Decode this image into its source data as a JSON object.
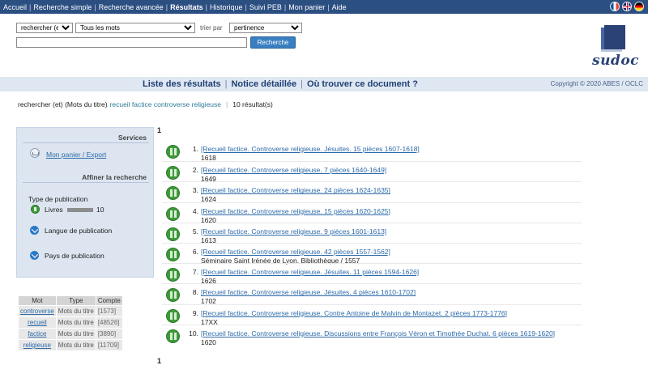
{
  "nav": {
    "items": [
      {
        "label": "Accueil",
        "active": false
      },
      {
        "label": "Recherche simple",
        "active": false
      },
      {
        "label": "Recherche avancée",
        "active": false
      },
      {
        "label": "Résultats",
        "active": true
      },
      {
        "label": "Historique",
        "active": false
      },
      {
        "label": "Suivi PEB",
        "active": false
      },
      {
        "label": "Mon panier",
        "active": false
      },
      {
        "label": "Aide",
        "active": false
      }
    ],
    "separator": "|",
    "flags": [
      "flag-fr-icon",
      "flag-gb-icon",
      "flag-de-icon"
    ]
  },
  "search": {
    "operator_value": "rechercher (et)",
    "field_value": "Tous les mots",
    "sort_label": "trier par",
    "sort_value": "pertinence",
    "query_value": "",
    "button_label": "Recherche"
  },
  "logo": {
    "text": "sudoc"
  },
  "tabs": {
    "items": [
      "Liste des résultats",
      "Notice détaillée",
      "Où trouver ce document ?"
    ],
    "separator": "|",
    "copyright": "Copyright © 2020 ABES / OCLC"
  },
  "breadcrumb": {
    "prefix": "rechercher (et) (Mots du titre)",
    "terms": "recueil factice controverse religieuse",
    "separator": "|",
    "count": "10 résultat(s)"
  },
  "panel": {
    "services_title": "Services",
    "basket_link": "Mon panier / Export",
    "refine_title": "Affiner la recherche",
    "pub_type_label": "Type de publication",
    "livres_label": "Livres",
    "livres_count": "10",
    "livres_fraction": 1.0,
    "langue_label": "Langue de publication",
    "pays_label": "Pays de publication"
  },
  "terms_table": {
    "headers": [
      "Mot",
      "Type",
      "Compte"
    ],
    "rows": [
      {
        "word": "controverse",
        "type": "Mots du titre",
        "count": "[1573]"
      },
      {
        "word": "recueil",
        "type": "Mots du titre",
        "count": "[48526]"
      },
      {
        "word": "factice",
        "type": "Mots du titre",
        "count": "[3890]"
      },
      {
        "word": "religieuse",
        "type": "Mots du titre",
        "count": "[11709]"
      }
    ]
  },
  "pager": {
    "top": "1",
    "bottom": "1"
  },
  "results": [
    {
      "num": "1.",
      "title": "[Recueil factice. Controverse religieuse. Jésuites. 15 pièces 1607-1618]",
      "meta": "1618"
    },
    {
      "num": "2.",
      "title": "[Recueil factice. Controverse religieuse. 7 pièces 1640-1649]",
      "meta": "1649"
    },
    {
      "num": "3.",
      "title": "[Recueil factice. Controverse religieuse. 24 pièces 1624-1635]",
      "meta": "1624"
    },
    {
      "num": "4.",
      "title": "[Recueil factice. Controverse religieuse. 15 pièces 1620-1625]",
      "meta": "1620"
    },
    {
      "num": "5.",
      "title": "[Recueil factice. Controverse religieuse. 9 pièces 1601-1613]",
      "meta": "1613"
    },
    {
      "num": "6.",
      "title": "[Recueil factice. Controverse religieuse. 42 pièces 1557-1562]",
      "meta": "Séminaire Saint Irénée de Lyon. Bibliothèque / 1557"
    },
    {
      "num": "7.",
      "title": "[Recueil factice. Controverse religieuse. Jésuites. 11 pièces 1594-1626]",
      "meta": "1626"
    },
    {
      "num": "8.",
      "title": "[Recueil factice. Controverse religieuse. Jésuites. 4 pièces 1610-1702]",
      "meta": "1702"
    },
    {
      "num": "9.",
      "title": "[Recueil factice. Controverse religieuse. Contre Antoine de Malvin de Montazet. 2 pièces 1773-1776]",
      "meta": "17XX"
    },
    {
      "num": "10.",
      "title": "[Recueil factice. Controverse religieuse. Discussions entre François Véron et Timothée Duchat. 6 pièces 1619-1620]",
      "meta": "1620"
    }
  ]
}
